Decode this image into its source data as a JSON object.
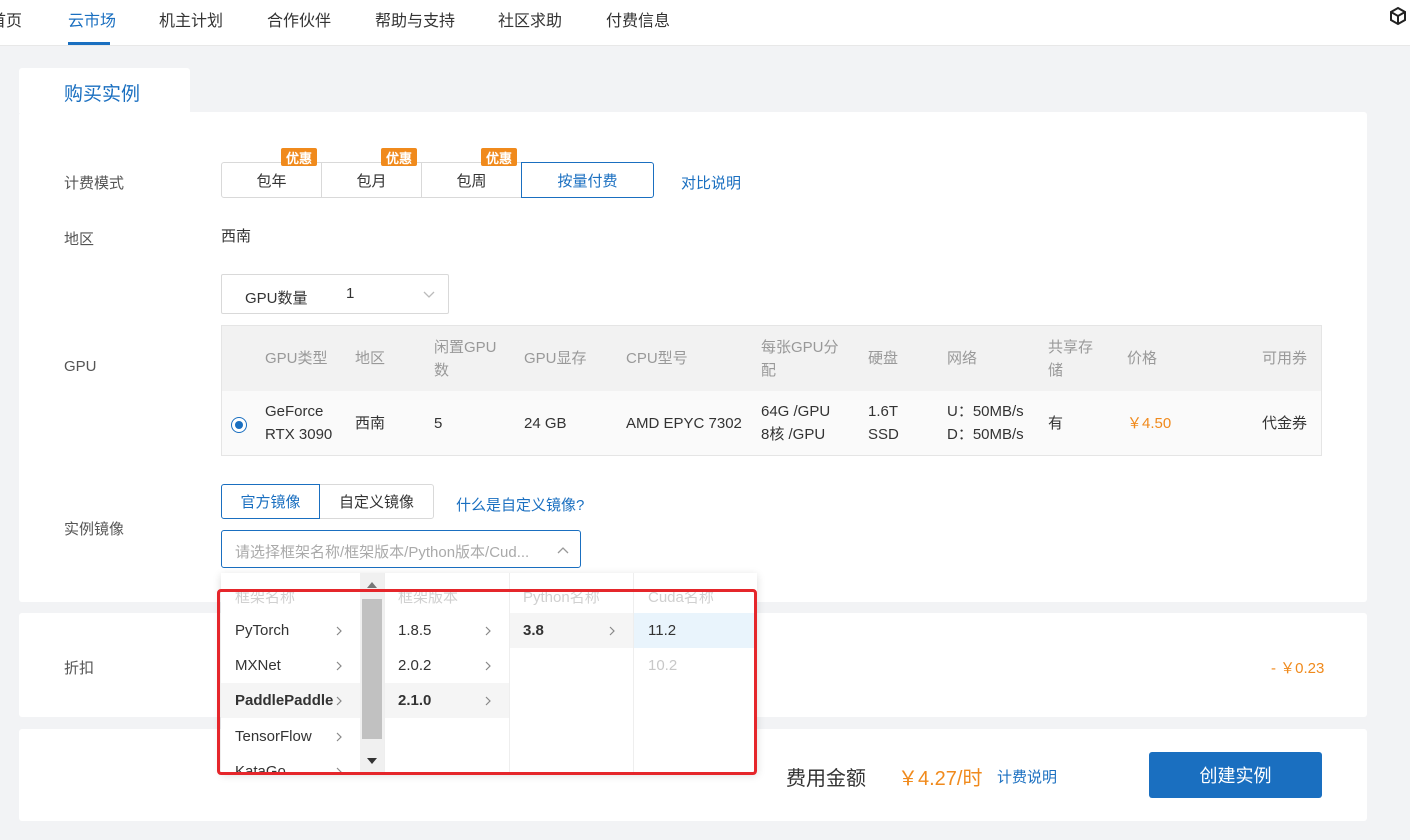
{
  "nav": {
    "items": [
      "首页",
      "云市场",
      "机主计划",
      "合作伙伴",
      "帮助与支持",
      "社区求助",
      "付费信息"
    ],
    "active": "云市场",
    "right_icon": "cube-icon"
  },
  "page_tab": "购买实例",
  "billing": {
    "label": "计费模式",
    "options": [
      "包年",
      "包月",
      "包周",
      "按量付费"
    ],
    "promo_badge": "优惠",
    "selected": "按量付费",
    "compare_link": "对比说明"
  },
  "region": {
    "label": "地区",
    "value": "西南"
  },
  "gpu": {
    "label": "GPU",
    "count_label": "GPU数量",
    "count_value": "1",
    "table": {
      "headers": [
        "GPU类型",
        "地区",
        "闲置GPU数",
        "GPU显存",
        "CPU型号",
        "每张GPU分配",
        "硬盘",
        "网络",
        "共享存储",
        "价格",
        "可用券"
      ],
      "row": {
        "type_line1": "GeForce",
        "type_line2": "RTX 3090",
        "region": "西南",
        "idle": "5",
        "memory": "24 GB",
        "cpu": "AMD EPYC 7302",
        "alloc_line1": "64G /GPU",
        "alloc_line2": "8核 /GPU",
        "disk_line1": "1.6T",
        "disk_line2": "SSD",
        "net_line1": "U：50MB/s",
        "net_line2": "D：50MB/s",
        "shared": "有",
        "price": "￥4.50",
        "coupon": "代金券"
      }
    }
  },
  "image": {
    "label": "实例镜像",
    "tabs": [
      "官方镜像",
      "自定义镜像"
    ],
    "selected_tab": "官方镜像",
    "help_link": "什么是自定义镜像?",
    "placeholder": "请选择框架名称/框架版本/Python版本/Cud...",
    "dropdown": {
      "headers": [
        "框架名称",
        "框架版本",
        "Python名称",
        "Cuda名称"
      ],
      "frameworks": [
        "PyTorch",
        "MXNet",
        "PaddlePaddle",
        "TensorFlow",
        "KataGo"
      ],
      "selected_framework": "PaddlePaddle",
      "versions": [
        "1.8.5",
        "2.0.2",
        "2.1.0"
      ],
      "selected_version": "2.1.0",
      "python": [
        "3.8"
      ],
      "cuda": [
        "11.2",
        "10.2"
      ],
      "cuda_disabled": "10.2"
    }
  },
  "discount": {
    "label": "折扣",
    "value": "- ￥0.23"
  },
  "summary": {
    "fee_label": "费用金额",
    "fee_value": "￥4.27/时",
    "fee_link": "计费说明",
    "create_button": "创建实例"
  },
  "colors": {
    "primary": "#1a6fc0",
    "accent": "#f08a1c",
    "highlight": "#e5262b"
  }
}
